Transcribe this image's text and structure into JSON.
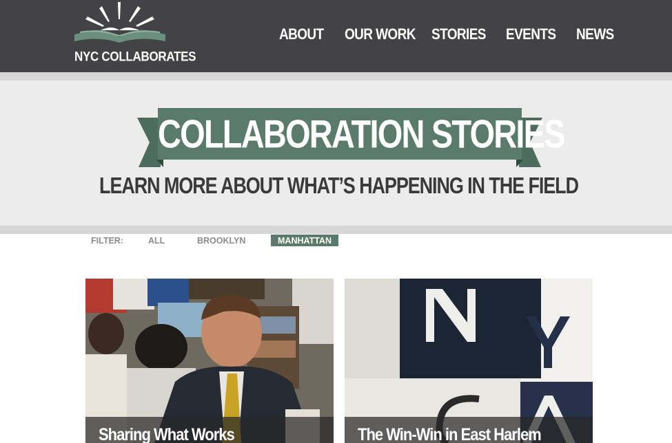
{
  "brand": {
    "name": "NYC COLLABORATES"
  },
  "nav": {
    "items": [
      {
        "label": "ABOUT"
      },
      {
        "label": "OUR WORK"
      },
      {
        "label": "STORIES"
      },
      {
        "label": "EVENTS"
      },
      {
        "label": "NEWS"
      }
    ]
  },
  "hero": {
    "title": "COLLABORATION STORIES",
    "subtitle": "LEARN MORE ABOUT WHAT’S HAPPENING IN THE FIELD"
  },
  "filter": {
    "label": "FILTER:",
    "options": [
      "ALL",
      "BROOKLYN",
      "MANHATTAN"
    ],
    "selected": "MANHATTAN"
  },
  "stories": [
    {
      "title": "Sharing What Works"
    },
    {
      "title": "The Win-Win in East Harlem"
    }
  ],
  "colors": {
    "header_bg": "#434244",
    "accent_green": "#5a7a6b",
    "hero_bg": "#ececec"
  }
}
